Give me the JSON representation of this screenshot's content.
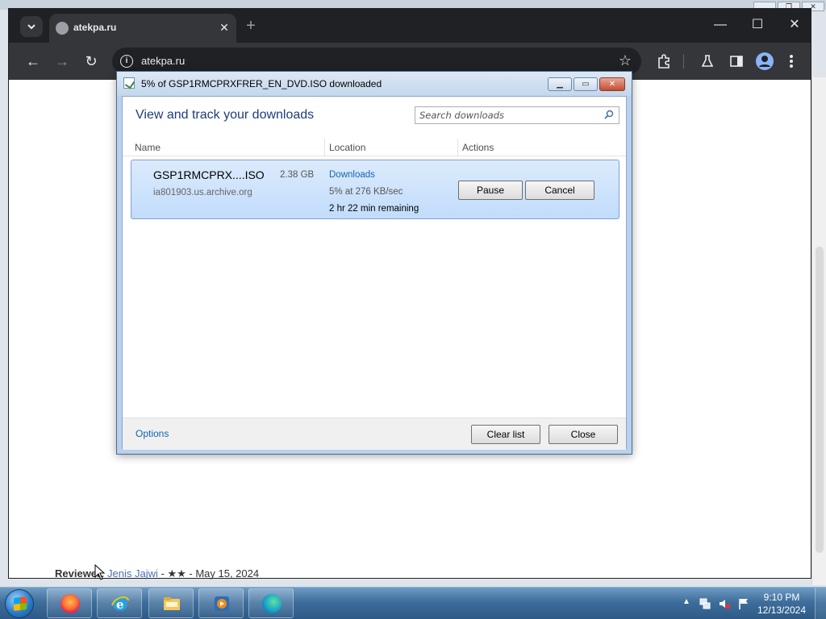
{
  "desktop": {
    "bg_controls": [
      "",
      "❐",
      "✕"
    ]
  },
  "browser": {
    "tab_title": "atekpa.ru",
    "tab_close": "✕",
    "new_tab": "+",
    "window_controls": [
      "—",
      "☐",
      "✕"
    ],
    "url": "atekpa.ru",
    "nav": {
      "back": "←",
      "forward": "→",
      "reload": "↻"
    },
    "toolbar_icons": [
      "extensions-icon",
      "labs-icon",
      "side-panel-icon",
      "profile-icon",
      "menu-icon"
    ]
  },
  "page": {
    "reviewer_label": "Reviewer:",
    "reviewer_name": "Jenis Jajwi",
    "reviewer_rest": " - ★★ - May 15, 2024"
  },
  "dialog": {
    "title": "5% of GSP1RMCPRXFRER_EN_DVD.ISO downloaded",
    "heading": "View and track your downloads",
    "search_placeholder": "Search downloads",
    "columns": [
      "Name",
      "Location",
      "Actions"
    ],
    "download": {
      "filename": "GSP1RMCPRX....ISO",
      "size": "2.38 GB",
      "source": "ia801903.us.archive.org",
      "location": "Downloads",
      "progress": "5% at 276 KB/sec",
      "remaining": "2 hr 22 min remaining",
      "percent_complete": 5
    },
    "pause_label": "Pause",
    "cancel_label": "Cancel",
    "options_label": "Options",
    "clear_list_label": "Clear list",
    "close_label": "Close"
  },
  "taskbar": {
    "apps": [
      "firefox-icon",
      "internet-explorer-icon",
      "file-explorer-icon",
      "media-player-icon",
      "edge-icon"
    ],
    "clock_time": "9:10 PM",
    "clock_date": "12/13/2024"
  }
}
